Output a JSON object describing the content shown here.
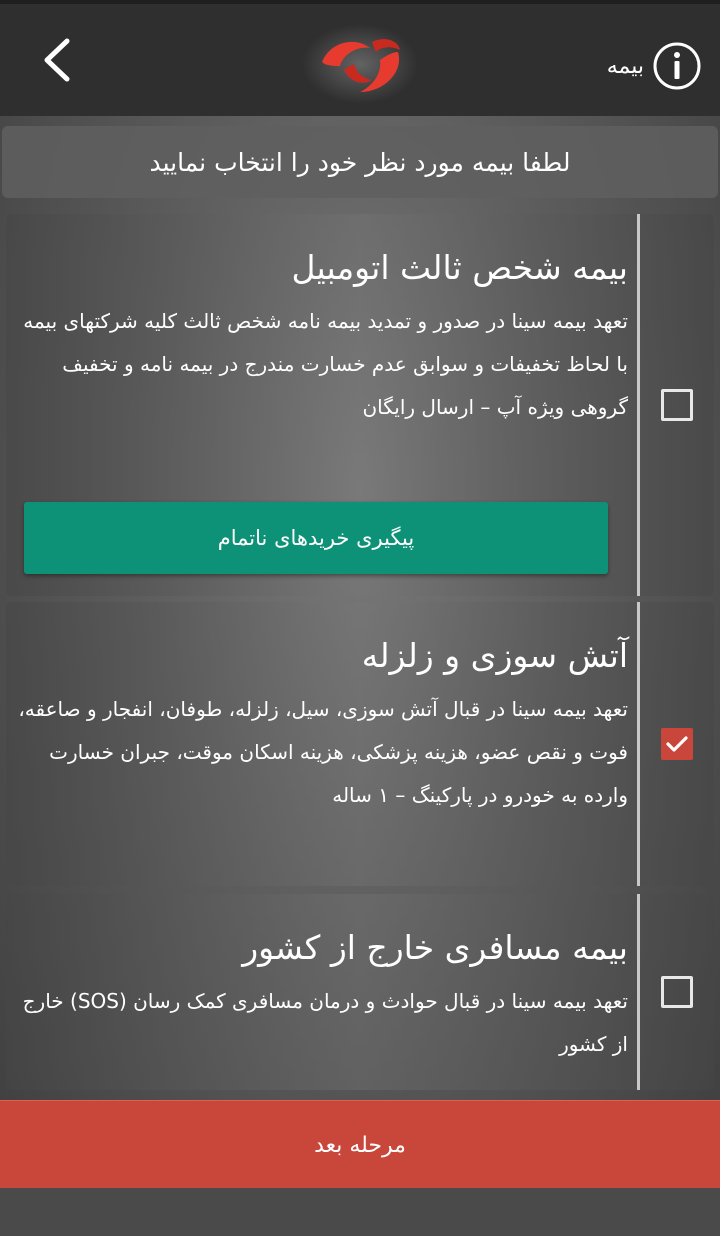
{
  "header": {
    "info_label": "بیمه",
    "icons": {
      "back": "chevron-left-icon",
      "info": "info-circle-icon",
      "logo": "brand-logo"
    },
    "colors": {
      "bar": "#2f2f2f",
      "logo_red": "#e63b2e"
    }
  },
  "prompt": "لطفا بیمه مورد نظر خود را انتخاب نمایید",
  "cards": [
    {
      "title": "بیمه شخص ثالث اتومبیل",
      "description": "تعهد بیمه سینا در صدور و تمدید بیمه نامه شخص ثالث کلیه شرکتهای بیمه با لحاظ تخفیفات و سوابق عدم خسارت مندرج در بیمه نامه و تخفیف گروهی ویژه آپ – ارسال رایگان",
      "checked": false,
      "button_label": "پیگیری خریدهای ناتمام"
    },
    {
      "title": "آتش سوزی و زلزله",
      "description": "تعهد بیمه سینا در قبال آتش سوزی، سیل، زلزله، طوفان، انفجار و صاعقه، فوت و نقص عضو، هزینه پزشکی، هزینه اسکان موقت، جبران خسارت وارده به خودرو در پارکینگ – ۱ ساله",
      "checked": true
    },
    {
      "title": "بیمه مسافری خارج از کشور",
      "description": "تعهد بیمه سینا در قبال حوادث و درمان مسافری کمک رسان (SOS) خارج از کشور",
      "checked": false
    }
  ],
  "next_button": "مرحله بعد",
  "colors": {
    "accent_red": "#c9473a",
    "green": "#0e9277"
  }
}
